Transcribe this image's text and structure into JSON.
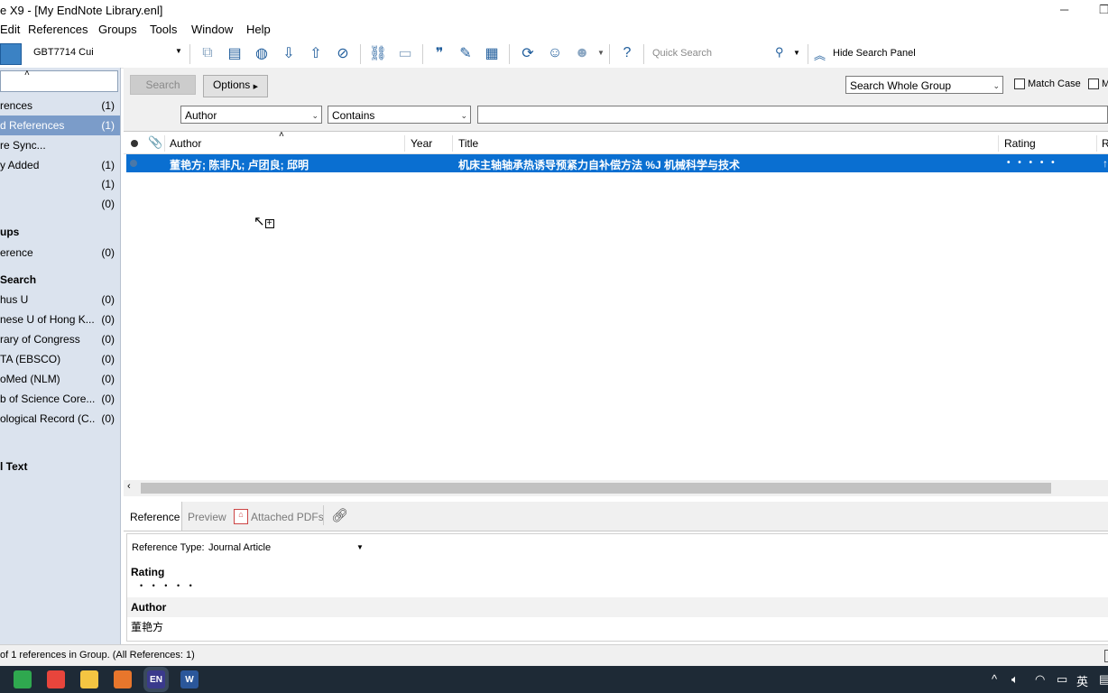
{
  "window": {
    "title": "e X9 - [My EndNote Library.enl]"
  },
  "menu": [
    "Edit",
    "References",
    "Groups",
    "Tools",
    "Window",
    "Help"
  ],
  "toolbar": {
    "style": "GBT7714 Cui",
    "quick_search_placeholder": "Quick Search",
    "hide_search_panel": "Hide Search Panel"
  },
  "left_panel": {
    "items": [
      {
        "label": "rences",
        "count": "(1)"
      },
      {
        "label": "d References",
        "count": "(1)",
        "selected": true
      },
      {
        "label": "re Sync...",
        "count": ""
      },
      {
        "label": "y Added",
        "count": "(1)"
      },
      {
        "label": "",
        "count": "(1)"
      },
      {
        "label": "",
        "count": "(0)"
      }
    ],
    "groups_header": "ups",
    "groups": [
      {
        "label": "erence",
        "count": "(0)"
      }
    ],
    "online_header": "Search",
    "online": [
      {
        "label": "hus U",
        "count": "(0)"
      },
      {
        "label": "nese U of Hong K...",
        "count": "(0)"
      },
      {
        "label": "rary of Congress",
        "count": "(0)"
      },
      {
        "label": "TA (EBSCO)",
        "count": "(0)"
      },
      {
        "label": "oMed (NLM)",
        "count": "(0)"
      },
      {
        "label": "b of Science Core...",
        "count": "(0)"
      },
      {
        "label": "ological Record (C...",
        "count": "(0)"
      }
    ],
    "fulltext_header": "l Text"
  },
  "search_panel": {
    "search_button": "Search",
    "options_button": "Options",
    "scope": "Search Whole Group",
    "match_case": "Match Case",
    "match_words_partial": "M",
    "field": "Author",
    "operator": "Contains",
    "value": ""
  },
  "list": {
    "columns": [
      "Author",
      "Year",
      "Title",
      "Rating",
      "R"
    ],
    "rows": [
      {
        "author": "董艳方; 陈非凡; 卢团良; 邱明",
        "year": "",
        "title": "机床主轴轴承热诱导预紧力自补偿方法 %J 机械科学与技术",
        "rating": "• • • • •"
      }
    ]
  },
  "bottom_tabs": {
    "reference": "Reference",
    "preview": "Preview",
    "attached_pdfs": "Attached PDFs"
  },
  "editor": {
    "ref_type_label": "Reference Type:",
    "ref_type_value": "Journal Article",
    "rating_label": "Rating",
    "rating_dots": "• • • • •",
    "author_label": "Author",
    "author_value": "董艳方"
  },
  "status": "of 1 references in Group. (All References: 1)",
  "taskbar": {
    "tray_lang": "英",
    "apps": [
      {
        "name": "app-green-icon",
        "color": "#2fa84f",
        "text": ""
      },
      {
        "name": "chrome-icon",
        "color": "#e8453c",
        "text": ""
      },
      {
        "name": "folder-icon",
        "color": "#f4c542",
        "text": ""
      },
      {
        "name": "search-app-icon",
        "color": "#e8762c",
        "text": ""
      },
      {
        "name": "endnote-icon",
        "color": "#3a3a8c",
        "text": "EN"
      },
      {
        "name": "word-icon",
        "color": "#2b579a",
        "text": "W"
      }
    ]
  }
}
